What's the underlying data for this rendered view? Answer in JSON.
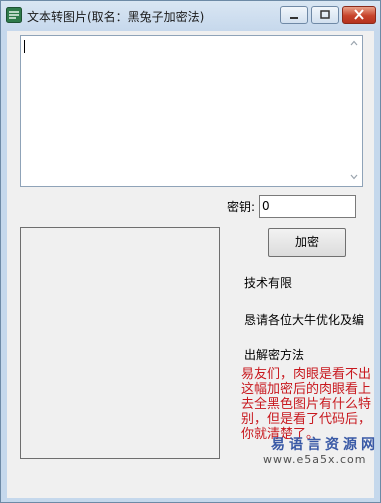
{
  "window": {
    "title": "文本转图片(取名：黑兔子加密法)",
    "icon": "app-icon",
    "controls": [
      "minimize-icon",
      "maximize-icon",
      "close-icon"
    ]
  },
  "main_text": {
    "value": ""
  },
  "key": {
    "label": "密钥:",
    "value": "0"
  },
  "encrypt_button": {
    "label": "加密"
  },
  "info": {
    "line1": "技术有限",
    "line2": "恳请各位大牛优化及编",
    "line3": "出解密方法",
    "note": "易友们，肉眼是看不出这幅加密后的肉眼看上去全黑色图片有什么特别，但是看了代码后，你就清楚了。"
  },
  "watermark": {
    "brand": "易语言资源网",
    "url": "www.e5a5x.com"
  },
  "colors": {
    "note_text": "#c8181e",
    "titlebar": "#c6d8ec",
    "close_button": "#c7432b"
  }
}
